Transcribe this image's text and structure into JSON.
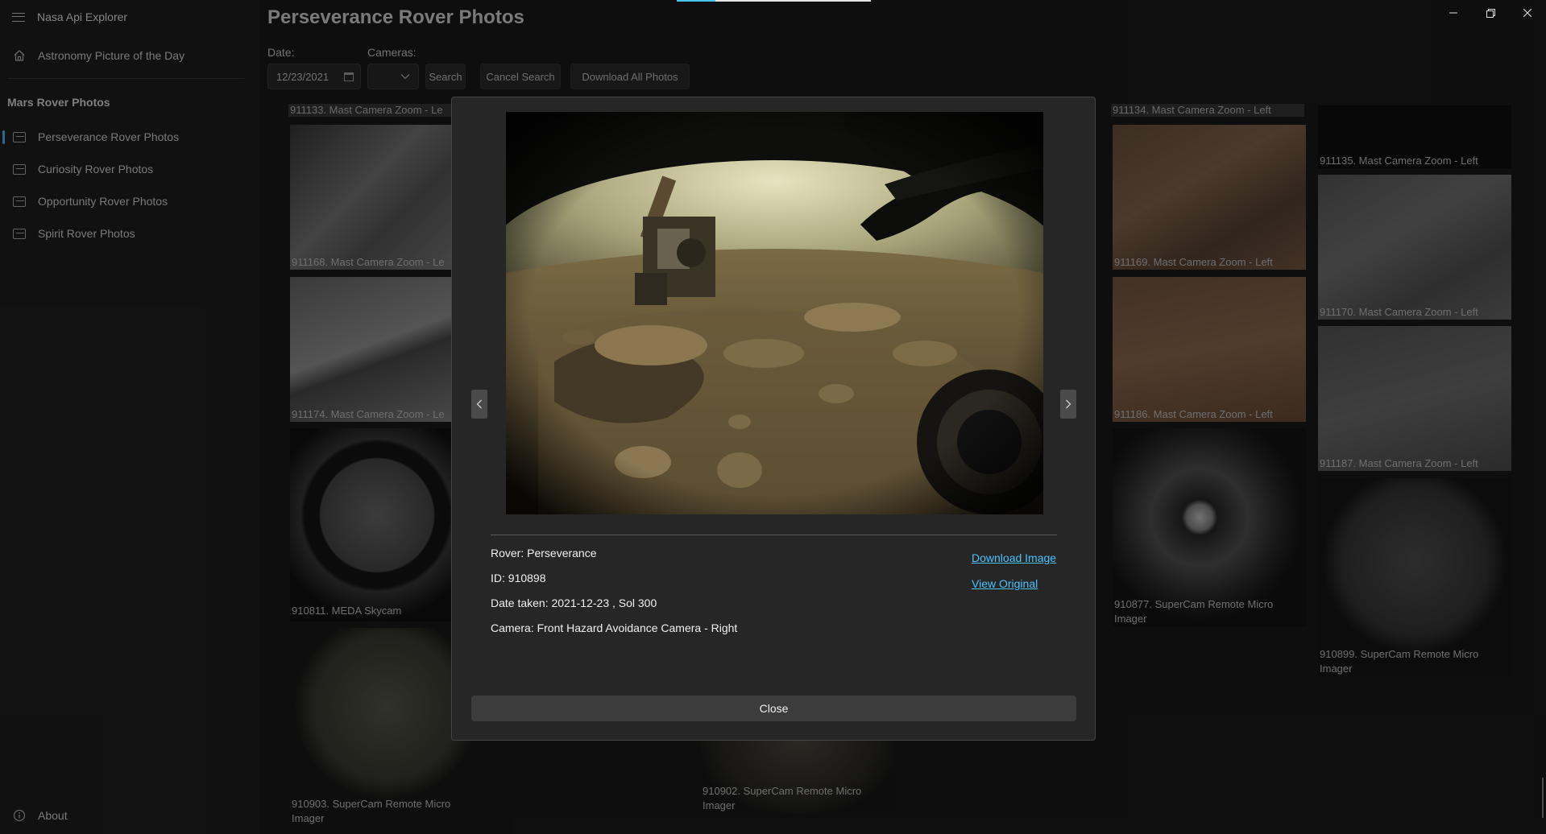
{
  "app": {
    "title": "Nasa Api Explorer"
  },
  "sidebar": {
    "apod": "Astronomy Picture of the Day",
    "section_header": "Mars Rover Photos",
    "items": [
      {
        "label": "Perseverance Rover Photos",
        "selected": true
      },
      {
        "label": "Curiosity Rover Photos",
        "selected": false
      },
      {
        "label": "Opportunity Rover Photos",
        "selected": false
      },
      {
        "label": "Spirit Rover Photos",
        "selected": false
      }
    ],
    "about": "About"
  },
  "page": {
    "title": "Perseverance Rover Photos",
    "date_label": "Date:",
    "date_value": "12/23/2021",
    "cameras_label": "Cameras:",
    "search_button": "Search",
    "cancel_button": "Cancel Search",
    "download_all_button": "Download All Photos"
  },
  "grid": {
    "col1": [
      "911133. Mast Camera Zoom - Le",
      "911168. Mast Camera Zoom - Le",
      "911174. Mast Camera Zoom - Le",
      "910811. MEDA Skycam",
      "910903. SuperCam Remote Micro Imager"
    ],
    "col2_bottom": "910902. SuperCam Remote Micro Imager",
    "col3": [
      "911134. Mast Camera Zoom - Left",
      "911169. Mast Camera Zoom - Left",
      "911186. Mast Camera Zoom - Left",
      "910877. SuperCam Remote Micro Imager"
    ],
    "col4": [
      "911135. Mast Camera Zoom - Left",
      "911170. Mast Camera Zoom - Left",
      "911187. Mast Camera Zoom - Left",
      "910899. SuperCam Remote Micro Imager"
    ]
  },
  "dialog": {
    "rover": "Rover: Perseverance",
    "id": "ID: 910898",
    "date_taken": "Date taken: 2021-12-23 , Sol 300",
    "camera": "Camera: Front Hazard Avoidance Camera - Right",
    "download_link": "Download Image",
    "view_link": "View Original",
    "close_button": "Close"
  },
  "colors": {
    "accent": "#4cc2ff",
    "background": "#202020"
  }
}
